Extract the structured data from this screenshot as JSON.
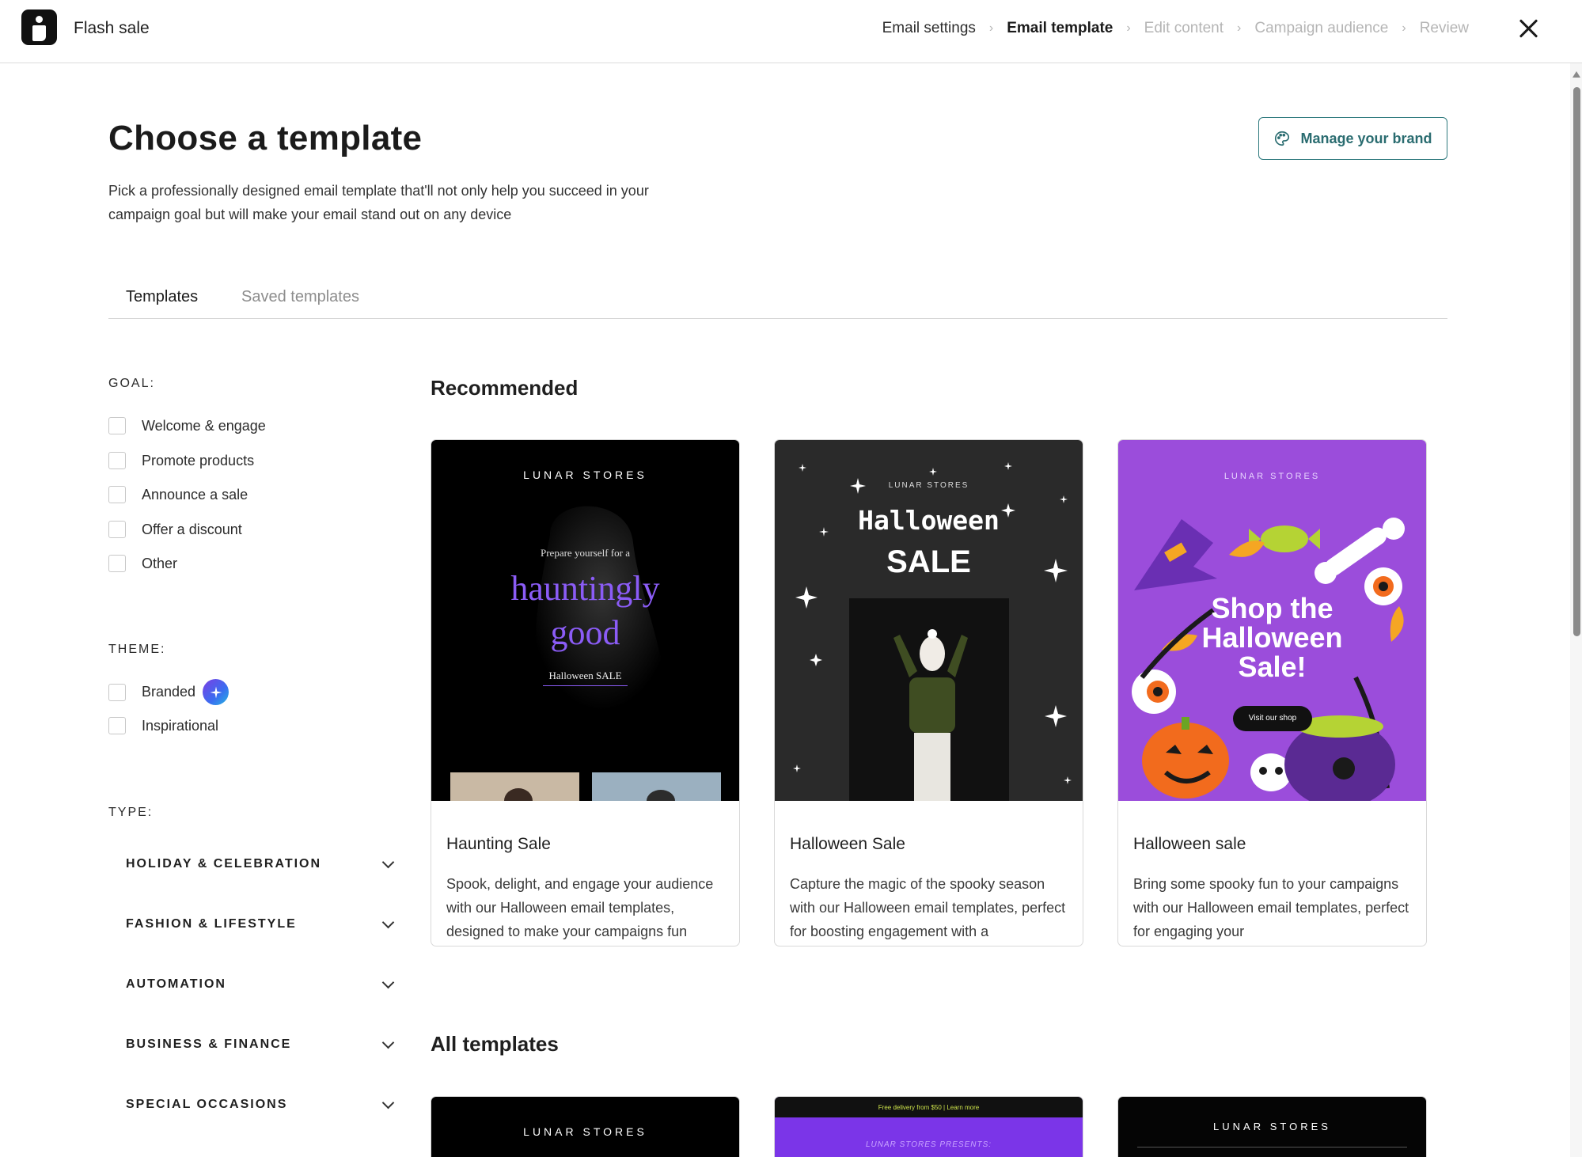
{
  "app": {
    "title": "Flash sale"
  },
  "steps": [
    {
      "label": "Email settings",
      "state": "done"
    },
    {
      "label": "Email template",
      "state": "active"
    },
    {
      "label": "Edit content",
      "state": "upcoming"
    },
    {
      "label": "Campaign audience",
      "state": "upcoming"
    },
    {
      "label": "Review",
      "state": "upcoming"
    }
  ],
  "header": {
    "title": "Choose a template",
    "description": "Pick a professionally designed email template that'll not only help you succeed in your campaign goal but will make your email stand out on any device",
    "brand_button": "Manage your brand"
  },
  "tabs": [
    "Templates",
    "Saved templates"
  ],
  "filters": {
    "goal_label": "GOAL:",
    "goals": [
      "Welcome & engage",
      "Promote products",
      "Announce a sale",
      "Offer a discount",
      "Other"
    ],
    "theme_label": "THEME:",
    "themes": [
      "Branded",
      "Inspirational"
    ],
    "type_label": "TYPE:",
    "types": [
      "HOLIDAY & CELEBRATION",
      "FASHION & LIFESTYLE",
      "AUTOMATION",
      "BUSINESS & FINANCE",
      "SPECIAL OCCASIONS"
    ]
  },
  "recommended": {
    "title": "Recommended",
    "cards": [
      {
        "name": "Haunting Sale",
        "description": "Spook, delight, and engage your audience with our Halloween email templates, designed to make your campaigns fun",
        "thumb": {
          "brand": "LUNAR STORES",
          "pre": "Prepare yourself for a",
          "headline1": "hauntingly",
          "headline2": "good",
          "sub": "Halloween SALE"
        }
      },
      {
        "name": "Halloween Sale",
        "description": "Capture the magic of the spooky season with our Halloween email templates, perfect for boosting engagement with a",
        "thumb": {
          "brand": "LUNAR STORES",
          "headline1": "Halloween",
          "headline2": "SALE"
        }
      },
      {
        "name": "Halloween sale",
        "description": "Bring some spooky fun to your campaigns with our Halloween email templates, perfect for engaging your",
        "thumb": {
          "brand": "LUNAR STORES",
          "headline1": "Shop the",
          "headline2": "Halloween",
          "headline3": "Sale!",
          "cta": "Visit our shop"
        }
      }
    ]
  },
  "all_templates": {
    "title": "All templates",
    "cards": [
      {
        "brand": "LUNAR STORES"
      },
      {
        "topline": "Free delivery from $50 | Learn more",
        "presents": "LUNAR STORES PRESENTS:"
      },
      {
        "brand": "LUNAR STORES"
      }
    ]
  },
  "colors": {
    "accent_teal": "#2a6c70",
    "purple_headline": "#8b5cf6",
    "halloween_purple": "#9b4ddb",
    "card_dark": "#2a2a2a"
  }
}
